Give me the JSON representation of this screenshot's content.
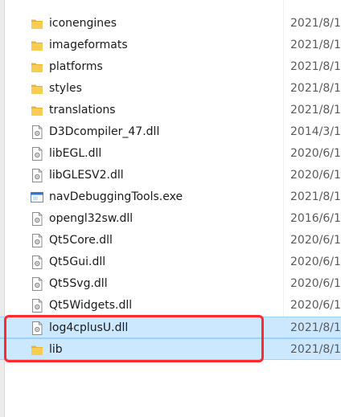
{
  "files": [
    {
      "name": "iconengines",
      "date": "2021/8/1",
      "type": "folder",
      "icon": "folder-icon"
    },
    {
      "name": "imageformats",
      "date": "2021/8/1",
      "type": "folder",
      "icon": "folder-icon"
    },
    {
      "name": "platforms",
      "date": "2021/8/1",
      "type": "folder",
      "icon": "folder-icon"
    },
    {
      "name": "styles",
      "date": "2021/8/1",
      "type": "folder",
      "icon": "folder-icon"
    },
    {
      "name": "translations",
      "date": "2021/8/1",
      "type": "folder",
      "icon": "folder-icon"
    },
    {
      "name": "D3Dcompiler_47.dll",
      "date": "2014/3/1",
      "type": "dll",
      "icon": "dll-file-icon"
    },
    {
      "name": "libEGL.dll",
      "date": "2020/6/1",
      "type": "dll",
      "icon": "dll-file-icon"
    },
    {
      "name": "libGLESV2.dll",
      "date": "2020/6/1",
      "type": "dll",
      "icon": "dll-file-icon"
    },
    {
      "name": "navDebuggingTools.exe",
      "date": "2021/8/1",
      "type": "exe",
      "icon": "exe-file-icon"
    },
    {
      "name": "opengl32sw.dll",
      "date": "2016/6/1",
      "type": "dll",
      "icon": "dll-file-icon"
    },
    {
      "name": "Qt5Core.dll",
      "date": "2020/6/1",
      "type": "dll",
      "icon": "dll-file-icon"
    },
    {
      "name": "Qt5Gui.dll",
      "date": "2020/6/1",
      "type": "dll",
      "icon": "dll-file-icon"
    },
    {
      "name": "Qt5Svg.dll",
      "date": "2020/6/1",
      "type": "dll",
      "icon": "dll-file-icon"
    },
    {
      "name": "Qt5Widgets.dll",
      "date": "2020/6/1",
      "type": "dll",
      "icon": "dll-file-icon"
    },
    {
      "name": "log4cplusU.dll",
      "date": "2021/8/1",
      "type": "dll",
      "icon": "dll-file-icon",
      "selected": true
    },
    {
      "name": "lib",
      "date": "2021/8/1",
      "type": "folder",
      "icon": "folder-icon",
      "selected": true
    }
  ],
  "colors": {
    "folder": "#f5c542",
    "selection": "#cce8ff",
    "highlight_border": "#ff2b2b"
  }
}
